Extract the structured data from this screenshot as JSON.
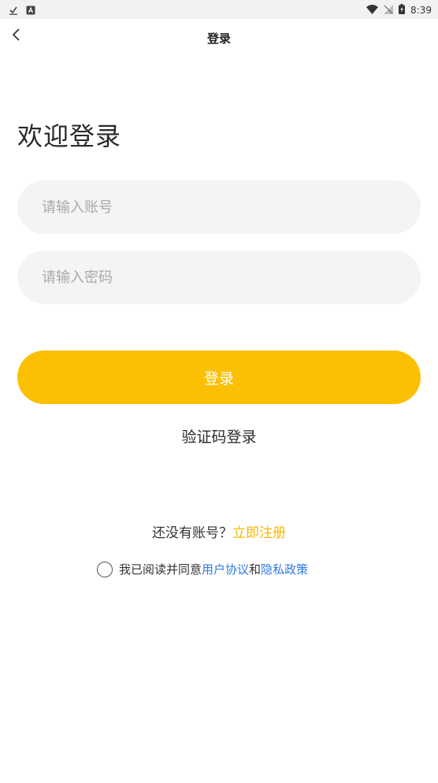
{
  "status_bar": {
    "time": "8:39"
  },
  "nav": {
    "title": "登录"
  },
  "welcome": "欢迎登录",
  "form": {
    "account_placeholder": "请输入账号",
    "password_placeholder": "请输入密码",
    "login_label": "登录",
    "code_login_label": "验证码登录"
  },
  "register": {
    "prompt": "还没有账号？",
    "link": "立即注册"
  },
  "agreement": {
    "text": "我已阅读并同意",
    "user_agreement": "用户协议",
    "and": "和",
    "privacy_policy": "隐私政策",
    "checked": false
  },
  "colors": {
    "accent": "#fbc003",
    "link": "#2f7be0",
    "register_link": "#f6b800"
  }
}
